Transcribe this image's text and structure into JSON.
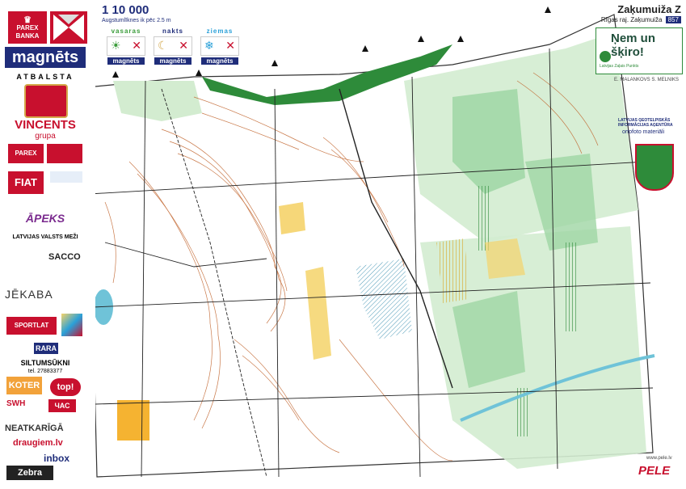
{
  "colors": {
    "forest_green": "#2e8b3a",
    "light_green": "#d3ecd0",
    "mid_green": "#9fd6a4",
    "open_yellow": "#f5d36a",
    "contour_brown": "#c0622a",
    "water_blue": "#6fc3d8",
    "track_black": "#222222",
    "sponsor_red": "#c8102e",
    "brand_navy": "#1f2d7a"
  },
  "header": {
    "scale": "1 10 000",
    "contour_note": "Augstumlīknes ik pēc 2.5 m",
    "seasons": [
      {
        "label": "vasaras",
        "brand": "magnēts",
        "color": "#3a9c3a"
      },
      {
        "label": "nakts",
        "brand": "magnēts",
        "color": "#1f2d7a"
      },
      {
        "label": "ziemas",
        "brand": "magnēts",
        "color": "#2aa0d8"
      }
    ]
  },
  "map_info": {
    "title": "Zaķumuiža Z",
    "region": "Rīgas raj. Zaķumuiža",
    "map_number": "857",
    "eco_slogan": "Ņem un šķiro!",
    "org_line": "Latvijas Zaļais Punkts",
    "authors": "E. MALANKOVS S. MELNIKS",
    "ortophoto_credit": "LATVIJAS ĢEOTELPISKĀS INFORMĀCIJAS AĢENTŪRA",
    "ortophoto_label": "ortofoto materiāli",
    "website": "www.pele.lv",
    "publisher": "PELE"
  },
  "sidebar": {
    "bank_logo": "PAREX BANKA",
    "main_sponsor": "magnēts",
    "supported_by": "ATBALSTA",
    "sponsors": [
      "VINCENTS",
      "grupa",
      "PAREX",
      "FIAT",
      "ĀPEKS",
      "LATVIJAS VALSTS MEŽI",
      "SACCO",
      "JĒKABA",
      "SPORTLAT",
      "RARA",
      "SILTUMSŪKNI",
      "tel. 27883377",
      "KOTER",
      "top!",
      "SWH",
      "NEATKARĪGĀ",
      "draugiem.lv",
      "inbox",
      "Zebra"
    ]
  }
}
